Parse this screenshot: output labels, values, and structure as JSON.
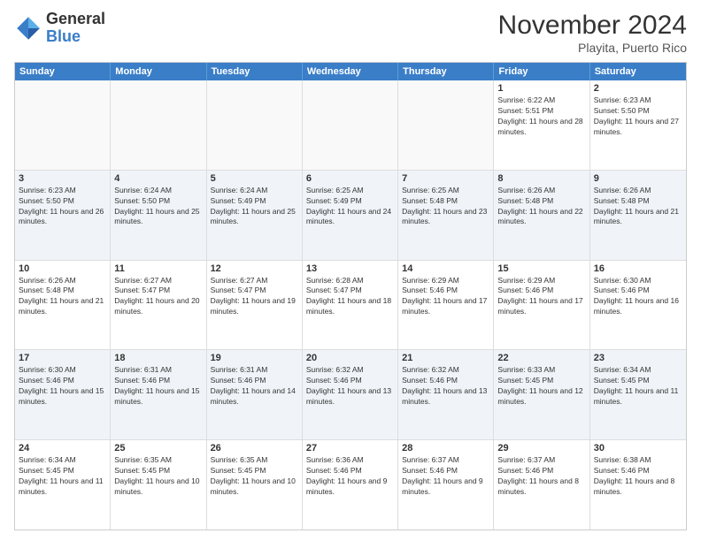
{
  "header": {
    "logo_line1": "General",
    "logo_line2": "Blue",
    "month_title": "November 2024",
    "location": "Playita, Puerto Rico"
  },
  "days_of_week": [
    "Sunday",
    "Monday",
    "Tuesday",
    "Wednesday",
    "Thursday",
    "Friday",
    "Saturday"
  ],
  "rows": [
    {
      "cells": [
        {
          "day": "",
          "empty": true
        },
        {
          "day": "",
          "empty": true
        },
        {
          "day": "",
          "empty": true
        },
        {
          "day": "",
          "empty": true
        },
        {
          "day": "",
          "empty": true
        },
        {
          "day": "1",
          "sunrise": "6:22 AM",
          "sunset": "5:51 PM",
          "daylight": "11 hours and 28 minutes."
        },
        {
          "day": "2",
          "sunrise": "6:23 AM",
          "sunset": "5:50 PM",
          "daylight": "11 hours and 27 minutes."
        }
      ]
    },
    {
      "cells": [
        {
          "day": "3",
          "sunrise": "6:23 AM",
          "sunset": "5:50 PM",
          "daylight": "11 hours and 26 minutes."
        },
        {
          "day": "4",
          "sunrise": "6:24 AM",
          "sunset": "5:50 PM",
          "daylight": "11 hours and 25 minutes."
        },
        {
          "day": "5",
          "sunrise": "6:24 AM",
          "sunset": "5:49 PM",
          "daylight": "11 hours and 25 minutes."
        },
        {
          "day": "6",
          "sunrise": "6:25 AM",
          "sunset": "5:49 PM",
          "daylight": "11 hours and 24 minutes."
        },
        {
          "day": "7",
          "sunrise": "6:25 AM",
          "sunset": "5:48 PM",
          "daylight": "11 hours and 23 minutes."
        },
        {
          "day": "8",
          "sunrise": "6:26 AM",
          "sunset": "5:48 PM",
          "daylight": "11 hours and 22 minutes."
        },
        {
          "day": "9",
          "sunrise": "6:26 AM",
          "sunset": "5:48 PM",
          "daylight": "11 hours and 21 minutes."
        }
      ]
    },
    {
      "cells": [
        {
          "day": "10",
          "sunrise": "6:26 AM",
          "sunset": "5:48 PM",
          "daylight": "11 hours and 21 minutes."
        },
        {
          "day": "11",
          "sunrise": "6:27 AM",
          "sunset": "5:47 PM",
          "daylight": "11 hours and 20 minutes."
        },
        {
          "day": "12",
          "sunrise": "6:27 AM",
          "sunset": "5:47 PM",
          "daylight": "11 hours and 19 minutes."
        },
        {
          "day": "13",
          "sunrise": "6:28 AM",
          "sunset": "5:47 PM",
          "daylight": "11 hours and 18 minutes."
        },
        {
          "day": "14",
          "sunrise": "6:29 AM",
          "sunset": "5:46 PM",
          "daylight": "11 hours and 17 minutes."
        },
        {
          "day": "15",
          "sunrise": "6:29 AM",
          "sunset": "5:46 PM",
          "daylight": "11 hours and 17 minutes."
        },
        {
          "day": "16",
          "sunrise": "6:30 AM",
          "sunset": "5:46 PM",
          "daylight": "11 hours and 16 minutes."
        }
      ]
    },
    {
      "cells": [
        {
          "day": "17",
          "sunrise": "6:30 AM",
          "sunset": "5:46 PM",
          "daylight": "11 hours and 15 minutes."
        },
        {
          "day": "18",
          "sunrise": "6:31 AM",
          "sunset": "5:46 PM",
          "daylight": "11 hours and 15 minutes."
        },
        {
          "day": "19",
          "sunrise": "6:31 AM",
          "sunset": "5:46 PM",
          "daylight": "11 hours and 14 minutes."
        },
        {
          "day": "20",
          "sunrise": "6:32 AM",
          "sunset": "5:46 PM",
          "daylight": "11 hours and 13 minutes."
        },
        {
          "day": "21",
          "sunrise": "6:32 AM",
          "sunset": "5:46 PM",
          "daylight": "11 hours and 13 minutes."
        },
        {
          "day": "22",
          "sunrise": "6:33 AM",
          "sunset": "5:45 PM",
          "daylight": "11 hours and 12 minutes."
        },
        {
          "day": "23",
          "sunrise": "6:34 AM",
          "sunset": "5:45 PM",
          "daylight": "11 hours and 11 minutes."
        }
      ]
    },
    {
      "cells": [
        {
          "day": "24",
          "sunrise": "6:34 AM",
          "sunset": "5:45 PM",
          "daylight": "11 hours and 11 minutes."
        },
        {
          "day": "25",
          "sunrise": "6:35 AM",
          "sunset": "5:45 PM",
          "daylight": "11 hours and 10 minutes."
        },
        {
          "day": "26",
          "sunrise": "6:35 AM",
          "sunset": "5:45 PM",
          "daylight": "11 hours and 10 minutes."
        },
        {
          "day": "27",
          "sunrise": "6:36 AM",
          "sunset": "5:46 PM",
          "daylight": "11 hours and 9 minutes."
        },
        {
          "day": "28",
          "sunrise": "6:37 AM",
          "sunset": "5:46 PM",
          "daylight": "11 hours and 9 minutes."
        },
        {
          "day": "29",
          "sunrise": "6:37 AM",
          "sunset": "5:46 PM",
          "daylight": "11 hours and 8 minutes."
        },
        {
          "day": "30",
          "sunrise": "6:38 AM",
          "sunset": "5:46 PM",
          "daylight": "11 hours and 8 minutes."
        }
      ]
    }
  ]
}
